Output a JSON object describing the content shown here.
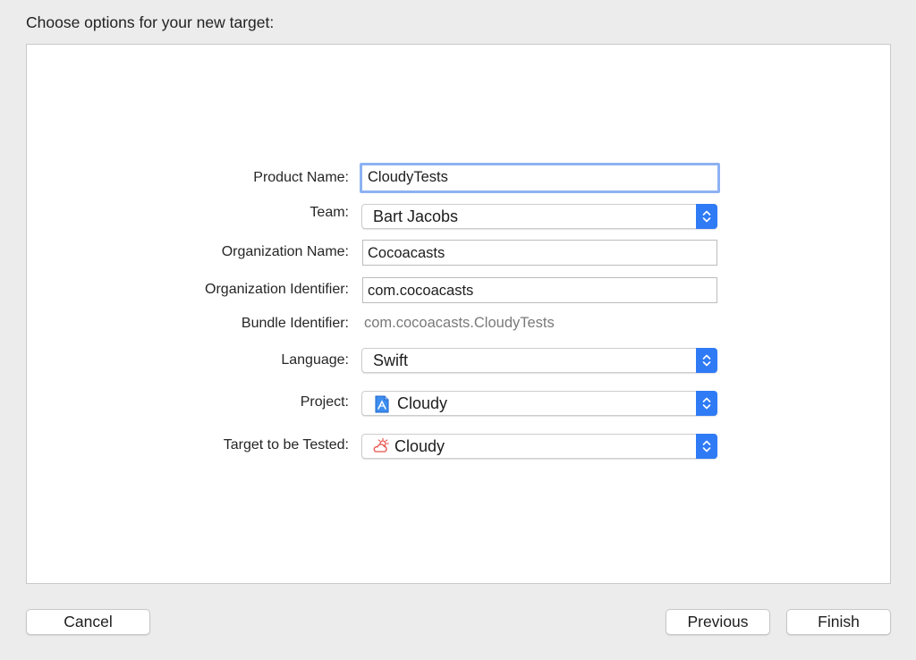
{
  "dialog": {
    "heading": "Choose options for your new target:"
  },
  "form": {
    "product_name": {
      "label": "Product Name:",
      "value": "CloudyTests"
    },
    "team": {
      "label": "Team:",
      "value": "Bart Jacobs"
    },
    "organization_name": {
      "label": "Organization Name:",
      "value": "Cocoacasts"
    },
    "organization_identifier": {
      "label": "Organization Identifier:",
      "value": "com.cocoacasts"
    },
    "bundle_identifier": {
      "label": "Bundle Identifier:",
      "value": "com.cocoacasts.CloudyTests"
    },
    "language": {
      "label": "Language:",
      "value": "Swift"
    },
    "project": {
      "label": "Project:",
      "value": "Cloudy",
      "icon": "xcode-project-icon"
    },
    "target_to_be_tested": {
      "label": "Target to be Tested:",
      "value": "Cloudy",
      "icon": "cloud-sun-app-icon"
    }
  },
  "buttons": {
    "cancel": "Cancel",
    "previous": "Previous",
    "finish": "Finish"
  },
  "colors": {
    "accent": "#2f7bf6",
    "focus_ring": "#8db2f3",
    "window_background": "#ececec",
    "secondary_text": "#7a7a7a"
  }
}
